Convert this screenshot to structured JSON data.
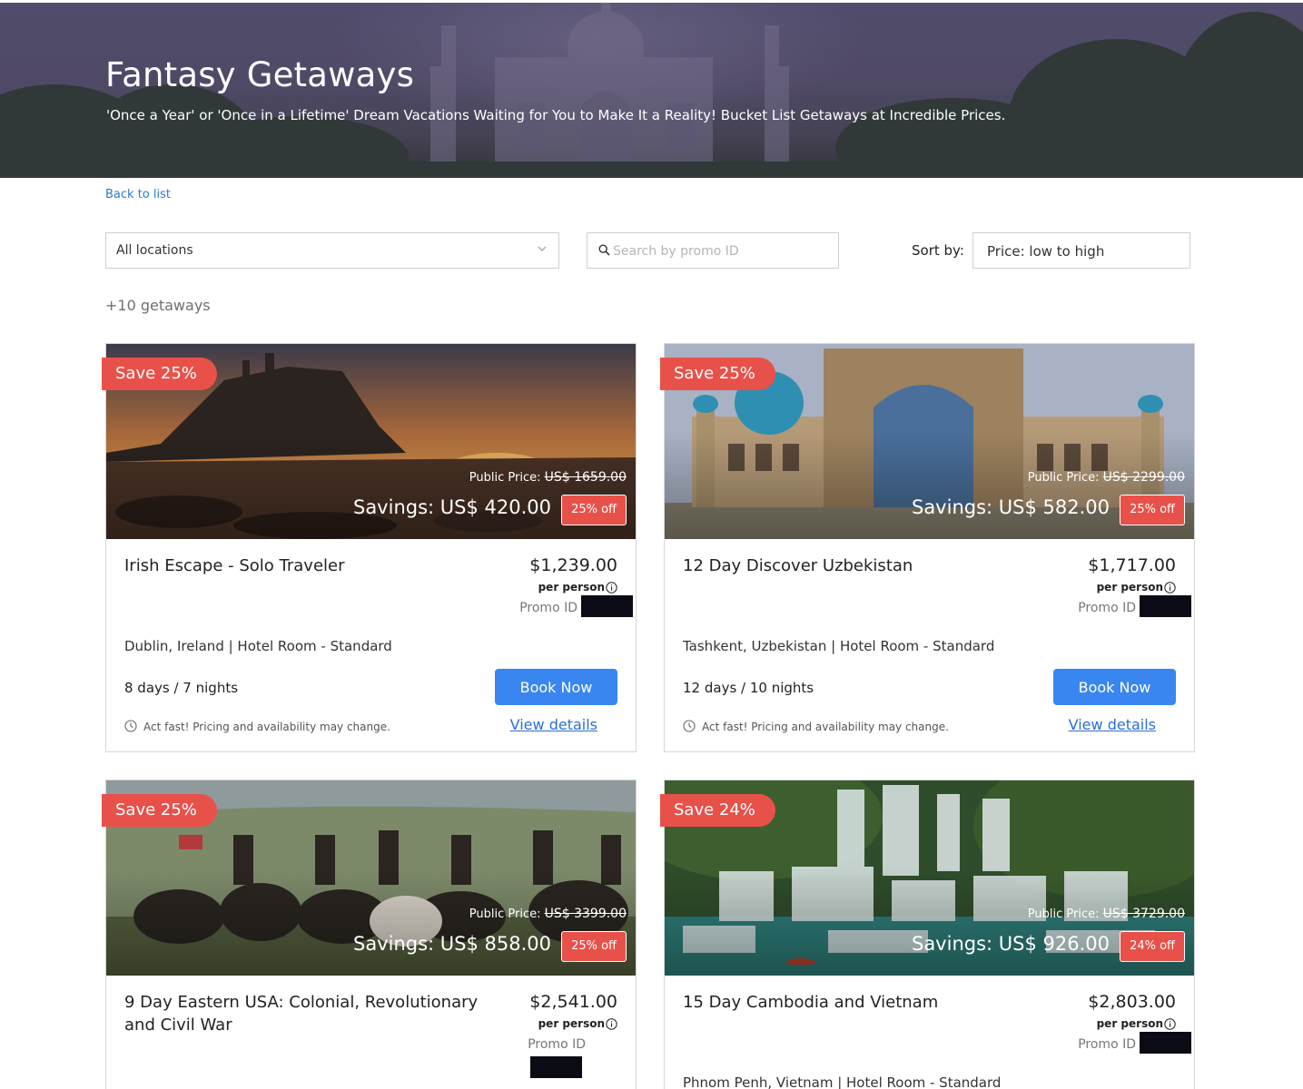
{
  "hero": {
    "title": "Fantasy Getaways",
    "subtitle": "'Once a Year' or 'Once in a Lifetime' Dream Vacations Waiting for You to Make It a Reality! Bucket List Getaways at Incredible Prices."
  },
  "nav": {
    "back_label": "Back to list"
  },
  "filters": {
    "location_value": "All locations",
    "search_placeholder": "Search by promo ID",
    "sort_label": "Sort by:",
    "sort_value": "Price: low to high"
  },
  "results": {
    "count_label": "+10 getaways"
  },
  "labels": {
    "public_price": "Public Price:",
    "per_person": "per person",
    "promo_id": "Promo ID",
    "book_now": "Book Now",
    "view_details": "View details",
    "act_fast": "Act fast! Pricing and availability may change."
  },
  "colors": {
    "accent_red": "#e8514a",
    "button_blue": "#3a86f0",
    "link_blue": "#2a6fd6"
  },
  "getaways": [
    {
      "save_badge": "Save 25%",
      "public_price": "US$ 1659.00",
      "savings": "Savings: US$ 420.00",
      "off_badge": "25% off",
      "title": "Irish Escape - Solo Traveler",
      "price": "$1,239.00",
      "location": "Dublin, Ireland | Hotel Room - Standard",
      "duration": "8 days / 7 nights",
      "image": "coastal-sunset-castle"
    },
    {
      "save_badge": "Save 25%",
      "public_price": "US$ 2299.00",
      "savings": "Savings: US$ 582.00",
      "off_badge": "25% off",
      "title": "12 Day Discover Uzbekistan",
      "price": "$1,717.00",
      "location": "Tashkent, Uzbekistan | Hotel Room - Standard",
      "duration": "12 days / 10 nights",
      "image": "blue-dome-madrasa"
    },
    {
      "save_badge": "Save 25%",
      "public_price": "US$ 3399.00",
      "savings": "Savings: US$ 858.00",
      "off_badge": "25% off",
      "title": "9 Day Eastern USA: Colonial, Revolutionary and Civil War",
      "price": "$2,541.00",
      "image": "civil-war-cavalry"
    },
    {
      "save_badge": "Save 24%",
      "public_price": "US$ 3729.00",
      "savings": "Savings: US$ 926.00",
      "off_badge": "24% off",
      "title": "15 Day Cambodia and Vietnam",
      "price": "$2,803.00",
      "location": "Phnom Penh, Vietnam | Hotel Room - Standard",
      "image": "jungle-waterfall"
    }
  ]
}
